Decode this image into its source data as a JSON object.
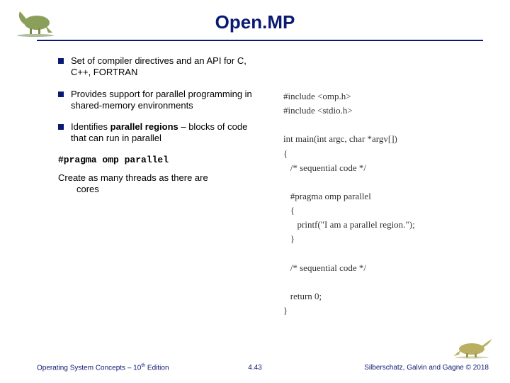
{
  "title": "Open.MP",
  "bullets": [
    "Set of compiler directives and an API for C, C++, FORTRAN",
    "Provides support for parallel programming in shared-memory environments",
    "Identifies <b>parallel regions</b> – blocks of code that can run in parallel"
  ],
  "pragma": "#pragma omp parallel",
  "plain_first": "Create as many threads as there are",
  "plain_hang": "cores",
  "code": "#include <omp.h>\n#include <stdio.h>\n\nint main(int argc, char *argv[])\n{\n   /* sequential code */\n\n   #pragma omp parallel\n   {\n      printf(\"I am a parallel region.\");\n   }\n\n   /* sequential code */\n\n   return 0;\n}",
  "footer": {
    "left_a": "Operating System Concepts – 10",
    "left_sup": "th",
    "left_b": " Edition",
    "center": "4.43",
    "right": "Silberschatz, Galvin and Gagne © 2018"
  }
}
